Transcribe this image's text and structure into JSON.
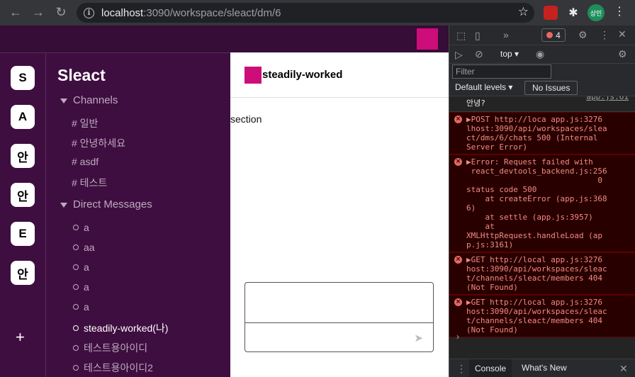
{
  "browser": {
    "url_host": "localhost",
    "url_rest": ":3090/workspace/sleact/dm/6",
    "profile_label": "상민"
  },
  "app": {
    "workspace_name": "Sleact",
    "workspaces": [
      "S",
      "A",
      "안",
      "안",
      "E",
      "안"
    ],
    "add_workspace": "+",
    "channels_section": "Channels",
    "channels": [
      "# 일반",
      "# 안녕하세요",
      "# asdf",
      "# 테스트"
    ],
    "dm_section": "Direct Messages",
    "dms": [
      "a",
      "aa",
      "a",
      "a",
      "a",
      "steadily-worked(나)",
      "테스트용아이디",
      "테스트용아이디2"
    ],
    "active_dm_index": 5,
    "dm_title": "steadily-worked",
    "section_text": "section",
    "send_icon": "send-icon",
    "brand_color": "#3f0e40",
    "header_color": "#350d36"
  },
  "devtools": {
    "error_count": "4",
    "context": "top",
    "filter_placeholder": "Filter",
    "levels": "Default levels",
    "no_issues": "No Issues",
    "logs": [
      {
        "type": "plain",
        "text": "안녕?",
        "src": "app.js:61"
      },
      {
        "type": "error",
        "lines": [
          "▶POST http://loca app.js:3276",
          "lhost:3090/api/workspaces/slea",
          "ct/dms/6/chats 500 (Internal",
          "Server Error)"
        ]
      },
      {
        "type": "error",
        "lines": [
          "▶Error: Request failed with",
          " react_devtools_backend.js:256",
          "                            0",
          "status code 500",
          "    at createError (app.js:368",
          "6)",
          "    at settle (app.js:3957)",
          "    at",
          "XMLHttpRequest.handleLoad (ap",
          "p.js:3161)"
        ]
      },
      {
        "type": "error",
        "lines": [
          "▶GET http://local app.js:3276",
          "host:3090/api/workspaces/sleac",
          "t/channels/sleact/members 404",
          "(Not Found)"
        ]
      },
      {
        "type": "error",
        "lines": [
          "▶GET http://local app.js:3276",
          "host:3090/api/workspaces/sleac",
          "t/channels/sleact/members 404",
          "(Not Found)"
        ]
      }
    ],
    "prompt": "›",
    "drawer_tabs": [
      "Console",
      "What's New"
    ]
  }
}
